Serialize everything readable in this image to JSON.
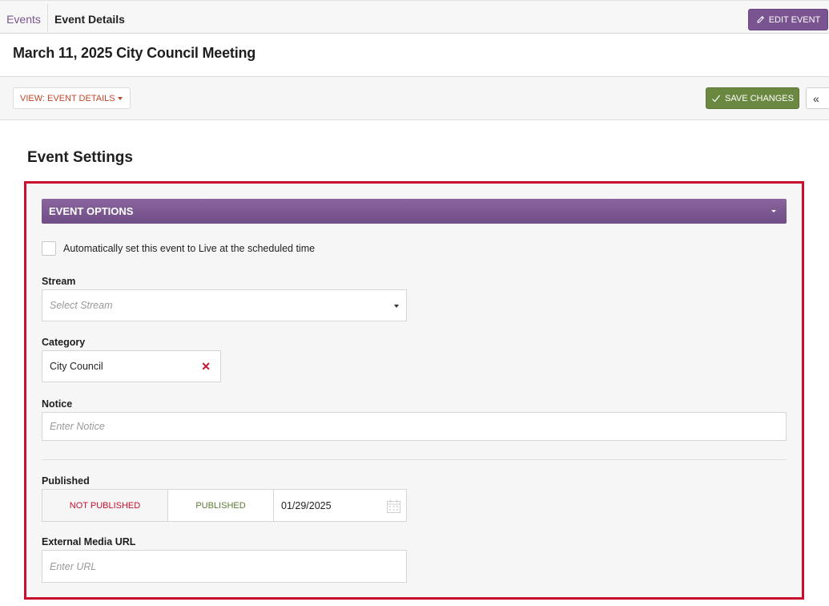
{
  "breadcrumb": {
    "root": "Events",
    "current": "Event Details"
  },
  "header": {
    "edit_label": "EDIT EVENT",
    "edit_icon": "pencil-icon"
  },
  "page": {
    "title": "March 11, 2025 City Council Meeting"
  },
  "toolbar": {
    "view_label": "VIEW: EVENT DETAILS",
    "save_label": "SAVE CHANGES",
    "save_icon": "checkmark-icon",
    "collapse_glyph": "«"
  },
  "settings": {
    "section_title": "Event Settings",
    "options_header": "EVENT OPTIONS",
    "auto_live": {
      "label": "Automatically set this event to Live at the scheduled time",
      "checked": false
    },
    "stream": {
      "label": "Stream",
      "placeholder": "Select Stream"
    },
    "category": {
      "label": "Category",
      "value": "City Council",
      "clear_glyph": "✕"
    },
    "notice": {
      "label": "Notice",
      "placeholder": "Enter Notice"
    },
    "published": {
      "label": "Published",
      "not_published_label": "NOT PUBLISHED",
      "published_label": "PUBLISHED",
      "selected": "PUBLISHED",
      "date": "01/29/2025",
      "date_icon": "calendar-icon"
    },
    "external_url": {
      "label": "External Media URL",
      "placeholder": "Enter URL"
    }
  },
  "colors": {
    "purple": "#7a5490",
    "green": "#6b8840",
    "red_outline": "#c8102e",
    "orange_text": "#c0462b"
  }
}
